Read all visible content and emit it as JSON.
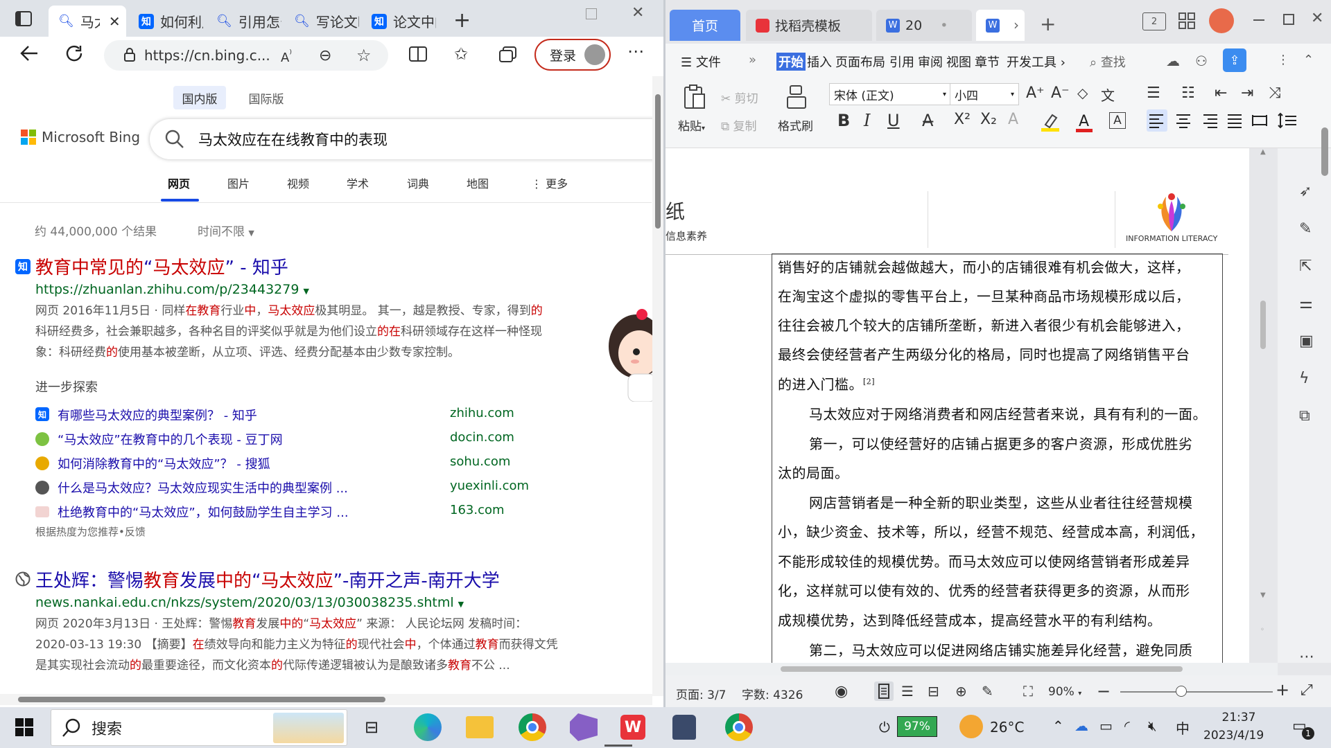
{
  "edge": {
    "tabs": [
      {
        "label": "马太效应",
        "icon": "search-icon"
      },
      {
        "label": "如何利用",
        "icon": "zhihu-icon"
      },
      {
        "label": "引用怎么",
        "icon": "search-icon"
      },
      {
        "label": "写论文时",
        "icon": "search-icon"
      },
      {
        "label": "论文中的",
        "icon": "zhihu-icon"
      }
    ],
    "address": "https://cn.bing.c...",
    "login_label": "登录"
  },
  "bing": {
    "market_tabs": [
      "国内版",
      "国际版"
    ],
    "logo_text": "Microsoft Bing",
    "query": "马太效应在在线教育中的表现",
    "nav": [
      "网页",
      "图片",
      "视频",
      "学术",
      "词典",
      "地图",
      "更多"
    ],
    "result_count": "约 44,000,000 个结果",
    "time_filter": "时间不限",
    "result1": {
      "title_parts": [
        {
          "t": "教育中常见的",
          "hl": true
        },
        {
          "t": "“",
          "hl": false
        },
        {
          "t": "马太效应",
          "hl": true
        },
        {
          "t": "”  - 知乎",
          "hl": false
        }
      ],
      "url": "https://zhuanlan.zhihu.com/p/23443279",
      "snippet_line1": [
        {
          "t": "网页 2016年11月5日 · 同样",
          "hl": false
        },
        {
          "t": "在教育",
          "hl": true
        },
        {
          "t": "行业",
          "hl": false
        },
        {
          "t": "中",
          "hl": true
        },
        {
          "t": "，",
          "hl": false
        },
        {
          "t": "马太效应",
          "hl": true
        },
        {
          "t": "极其明显。 其一，越是教授、专家，得到",
          "hl": false
        },
        {
          "t": "的",
          "hl": true
        }
      ],
      "snippet_line2": [
        {
          "t": "科研经费多，社会兼职越多，各种名目的评奖似乎就是为他们设立",
          "hl": false
        },
        {
          "t": "的在",
          "hl": true
        },
        {
          "t": "科研领域存在这样一种怪现",
          "hl": false
        }
      ],
      "snippet_line3": [
        {
          "t": "象：科研经费",
          "hl": false
        },
        {
          "t": "的",
          "hl": true
        },
        {
          "t": "使用基本被垄断，从立项、评选、经费分配基本由少数专家控制。",
          "hl": false
        }
      ],
      "explore_title": "进一步探索",
      "related": [
        {
          "text": "有哪些马太效应的典型案例？ - 知乎",
          "domain": "zhihu.com",
          "icon_color": "#0066ff"
        },
        {
          "text": "“马太效应”在教育中的几个表现 - 豆丁网",
          "domain": "docin.com",
          "icon_color": "#7dc242"
        },
        {
          "text": "如何消除教育中的“马太效应”？ - 搜狐",
          "domain": "sohu.com",
          "icon_color": "#e8a900"
        },
        {
          "text": "什么是马太效应？马太效应现实生活中的典型案例 ...",
          "domain": "yuexinli.com",
          "icon_color": "#555555"
        },
        {
          "text": "杜绝教育中的“马太效应”，如何鼓励学生自主学习 ...",
          "domain": "163.com",
          "icon_color": "#d33a31"
        }
      ],
      "footnote": "根据热度为您推荐•反馈"
    },
    "result2": {
      "title_parts": [
        {
          "t": "王处辉：警惕",
          "hl": false
        },
        {
          "t": "教育",
          "hl": true
        },
        {
          "t": "发展",
          "hl": false
        },
        {
          "t": "中的",
          "hl": true
        },
        {
          "t": "“",
          "hl": false
        },
        {
          "t": "马太效应",
          "hl": true
        },
        {
          "t": "”-南开之声-南开大学",
          "hl": false
        }
      ],
      "url": "news.nankai.edu.cn/nkzs/system/2020/03/13/030038235.shtml",
      "snippet_line1": [
        {
          "t": "网页 2020年3月13日 · 王处辉：警惕",
          "hl": false
        },
        {
          "t": "教育",
          "hl": true
        },
        {
          "t": "发展",
          "hl": false
        },
        {
          "t": "中的",
          "hl": true
        },
        {
          "t": "“",
          "hl": false
        },
        {
          "t": "马太效应",
          "hl": true
        },
        {
          "t": "” 来源： 人民论坛网 发稿时间：",
          "hl": false
        }
      ],
      "snippet_line2": [
        {
          "t": "2020-03-13 19:30 【摘要】",
          "hl": false
        },
        {
          "t": "在",
          "hl": true
        },
        {
          "t": "绩效导向和能力主义为特征",
          "hl": false
        },
        {
          "t": "的",
          "hl": true
        },
        {
          "t": "现代社会",
          "hl": false
        },
        {
          "t": "中",
          "hl": true
        },
        {
          "t": "，个体通过",
          "hl": false
        },
        {
          "t": "教育",
          "hl": true
        },
        {
          "t": "而获得文凭",
          "hl": false
        }
      ],
      "snippet_line3": [
        {
          "t": "是其实现社会流动",
          "hl": false
        },
        {
          "t": "的",
          "hl": true
        },
        {
          "t": "最重要途径，而文化资本",
          "hl": false
        },
        {
          "t": "的",
          "hl": true
        },
        {
          "t": "代际传递逻辑被认为是酿致诸多",
          "hl": false
        },
        {
          "t": "教育",
          "hl": true
        },
        {
          "t": "不公 ...",
          "hl": false
        }
      ]
    }
  },
  "wps": {
    "tabs": {
      "home": "首页",
      "template": "找稻壳模板",
      "doc1": "20",
      "doc2": ""
    },
    "menu": [
      "文件",
      "开始",
      "插入",
      "页面布局",
      "引用",
      "审阅",
      "视图",
      "章节",
      "开发工具"
    ],
    "search_label": "查找",
    "ribbon": {
      "paste": "粘贴",
      "cut": "剪切",
      "copy": "复制",
      "format_painter": "格式刷",
      "font_name": "宋体 (正文)",
      "font_size": "小四"
    },
    "header": {
      "left_text": "纸",
      "left_sub": "信息素养",
      "logo_text": "INFORMATION LITERACY"
    },
    "doc_lines": [
      "销售好的店铺就会越做越大，而小的店铺很难有机会做大，这样，",
      "在淘宝这个虚拟的零售平台上，一旦某种商品市场规模形成以后，",
      "往往会被几个较大的店铺所垄断，新进入者很少有机会能够进入，",
      "最终会使经营者产生两级分化的格局，同时也提高了网络销售平台",
      "的进入门槛。",
      "马太效应对于网络消费者和网店经营者来说，具有有利的一面。",
      "第一，可以使经营好的店铺占据更多的客户资源，形成优胜劣",
      "汰的局面。",
      "网店营销者是一种全新的职业类型，这些从业者往往经营规模",
      "小，缺少资金、技术等，所以，经营不规范、经营成本高，利润低，",
      "不能形成较佳的规模优势。而马太效应可以使网络营销者形成差异",
      "化，这样就可以使有效的、优秀的经营者获得更多的资源，从而形",
      "成规模优势，达到降低经营成本，提高经营水平的有利结构。",
      "第二，马太效应可以促进网络店铺实施差异化经营，避免同质"
    ],
    "citation": "[2]",
    "status": {
      "page": "页面: 3/7",
      "words": "字数: 4326",
      "zoom": "90%"
    }
  },
  "taskbar": {
    "search_placeholder": "搜索",
    "battery": "97%",
    "weather": "26°C",
    "ime": "中",
    "time": "21:37",
    "date": "2023/4/19",
    "notif_count": "1"
  }
}
